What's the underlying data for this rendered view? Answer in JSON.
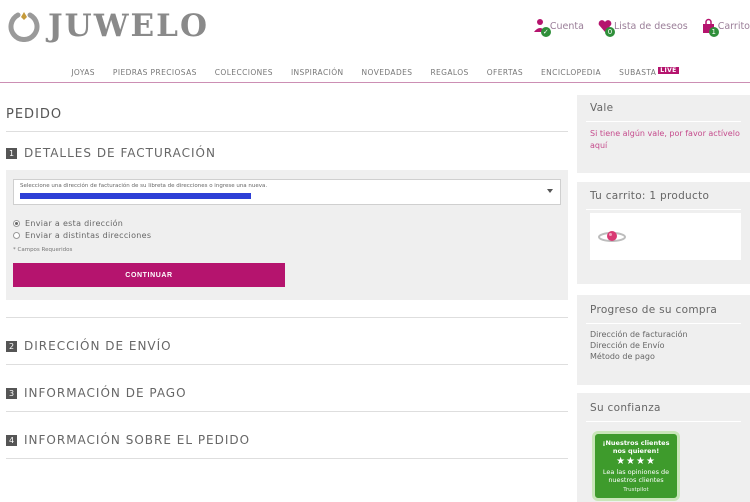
{
  "header": {
    "logo_text": "JUWELO",
    "links": {
      "account": "Cuenta",
      "wishlist": "Lista de deseos",
      "cart": "Carrito",
      "wishlist_count": "0",
      "cart_count": "1"
    }
  },
  "nav": {
    "items": [
      "JOYAS",
      "PIEDRAS PRECIOSAS",
      "COLECCIONES",
      "INSPIRACIÓN",
      "NOVEDADES",
      "REGALOS",
      "OFERTAS",
      "ENCICLOPEDIA",
      "SUBASTA"
    ],
    "live_badge": "LIVE"
  },
  "main": {
    "title": "PEDIDO",
    "steps": [
      {
        "num": "1",
        "label": "DETALLES DE FACTURACIÓN"
      },
      {
        "num": "2",
        "label": "DIRECCIÓN DE ENVÍO"
      },
      {
        "num": "3",
        "label": "INFORMACIÓN DE PAGO"
      },
      {
        "num": "4",
        "label": "INFORMACIÓN SOBRE EL PEDIDO"
      }
    ],
    "billing": {
      "select_label": "Seleccione una dirección de facturación de su libreta de direcciones o ingrese una nueva.",
      "radio_same": "Enviar a esta dirección",
      "radio_other": "Enviar a distintas direcciones",
      "required_note": "* Campos Requeridos",
      "continue_button": "CONTINUAR"
    }
  },
  "sidebar": {
    "vale": {
      "title": "Vale",
      "text": "Si tiene algún vale, por favor actívelo aquí"
    },
    "cart": {
      "title": "Tu carrito: 1 producto"
    },
    "progress": {
      "title": "Progreso de su compra",
      "items": [
        "Dirección de facturación",
        "Dirección de Envío",
        "Método de pago"
      ]
    },
    "trust": {
      "title": "Su confianza",
      "badge_line1": "¡Nuestros clientes",
      "badge_line2": "nos quieren!",
      "stars": "★★★★",
      "badge_line3": "Lea las opiniones de",
      "badge_line4": "nuestros clientes",
      "badge_brand": "Trustpilot"
    }
  },
  "colors": {
    "accent": "#b5146e",
    "link_pink": "#c54b8c",
    "panel_bg": "#efefef",
    "badge_green": "#2f8f3a"
  }
}
